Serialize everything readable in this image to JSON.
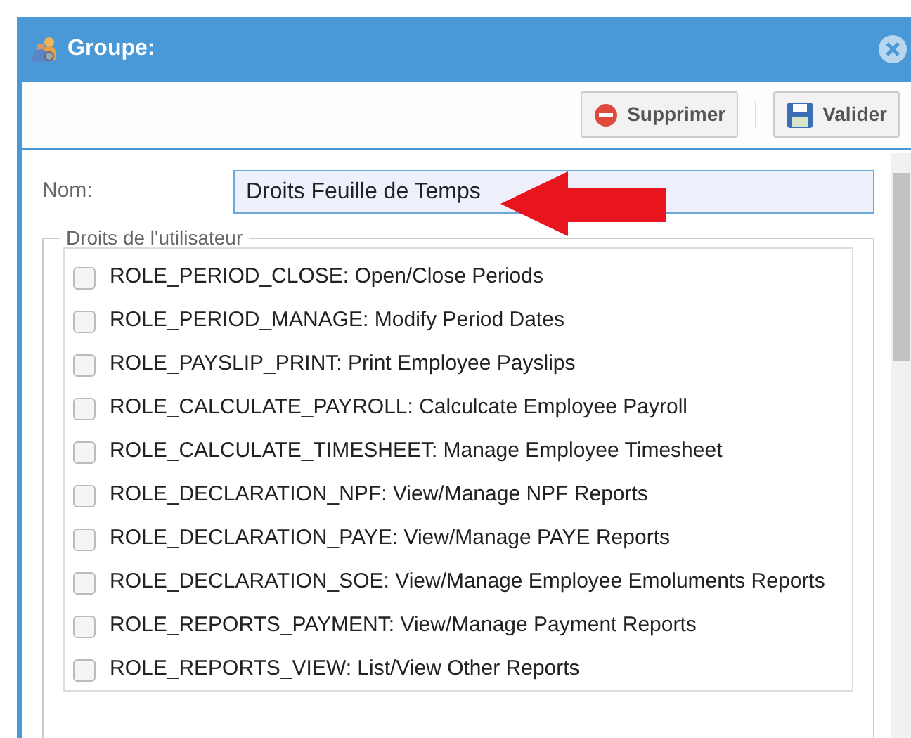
{
  "window": {
    "title": "Groupe:"
  },
  "toolbar": {
    "buttons": [
      {
        "label": "Supprimer",
        "kind": "delete"
      },
      {
        "label": "Valider",
        "kind": "save"
      }
    ]
  },
  "form": {
    "name_label": "Nom:",
    "name_value": "Droits Feuille de Temps",
    "rights": {
      "legend": "Droits de l'utilisateur",
      "items": [
        {
          "label": "ROLE_PERIOD_CLOSE: Open/Close Periods",
          "checked": false
        },
        {
          "label": "ROLE_PERIOD_MANAGE: Modify Period Dates",
          "checked": false
        },
        {
          "label": "ROLE_PAYSLIP_PRINT: Print Employee Payslips",
          "checked": false
        },
        {
          "label": "ROLE_CALCULATE_PAYROLL: Calculcate Employee Payroll",
          "checked": false
        },
        {
          "label": "ROLE_CALCULATE_TIMESHEET: Manage Employee Timesheet",
          "checked": false
        },
        {
          "label": "ROLE_DECLARATION_NPF: View/Manage NPF Reports",
          "checked": false
        },
        {
          "label": "ROLE_DECLARATION_PAYE: View/Manage PAYE Reports",
          "checked": false
        },
        {
          "label": "ROLE_DECLARATION_SOE: View/Manage Employee Emoluments Reports",
          "checked": false
        },
        {
          "label": "ROLE_REPORTS_PAYMENT: View/Manage Payment Reports",
          "checked": false
        },
        {
          "label": "ROLE_REPORTS_VIEW: List/View Other Reports",
          "checked": false
        }
      ]
    }
  }
}
